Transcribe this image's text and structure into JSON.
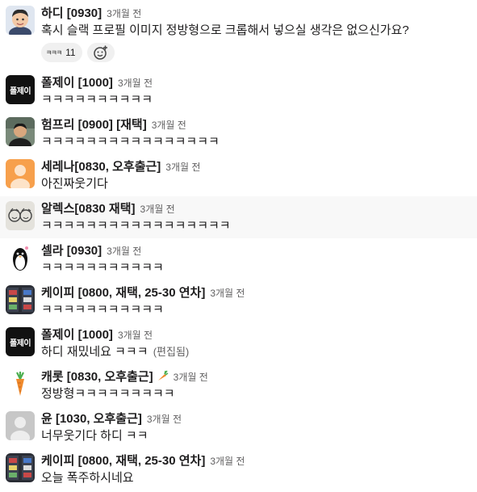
{
  "messages": [
    {
      "name": "하디 [0930]",
      "time": "3개월 전",
      "text": "혹시 슬랙 프로필 이미지 정방형으로 크롭해서 넣으실 생각은 없으신가요?"
    },
    {
      "name": "폴제이 [1000]",
      "time": "3개월 전",
      "text": "ㅋㅋㅋㅋㅋㅋㅋㅋㅋㅋ",
      "avatar_text": "폴제이"
    },
    {
      "name": "험프리 [0900] [재택]",
      "time": "3개월 전",
      "text": "ㅋㅋㅋㅋㅋㅋㅋㅋㅋㅋㅋㅋㅋㅋㅋㅋ"
    },
    {
      "name": "세레나[0830, 오후출근]",
      "time": "3개월 전",
      "text": "아진짜웃기다"
    },
    {
      "name": "알렉스[0830 재택]",
      "time": "3개월 전",
      "text": "ㅋㅋㅋㅋㅋㅋㅋㅋㅋㅋㅋㅋㅋㅋㅋㅋㅋ"
    },
    {
      "name": "셀라 [0930]",
      "time": "3개월 전",
      "text": "ㅋㅋㅋㅋㅋㅋㅋㅋㅋㅋㅋ"
    },
    {
      "name": "케이피 [0800, 재택, 25-30 연차]",
      "time": "3개월 전",
      "text": "ㅋㅋㅋㅋㅋㅋㅋㅋㅋㅋㅋ"
    },
    {
      "name": "폴제이 [1000]",
      "time": "3개월 전",
      "text": "하디 재밌네요 ㅋㅋㅋ",
      "edited": "(편집됨)",
      "avatar_text": "폴제이"
    },
    {
      "name": "캐롯 [0830, 오후출근]",
      "time": "3개월 전",
      "text": "정방형ㅋㅋㅋㅋㅋㅋㅋㅋㅋ"
    },
    {
      "name": "윤 [1030, 오후출근]",
      "time": "3개월 전",
      "text": "너무웃기다 하디 ㅋㅋ"
    },
    {
      "name": "케이피 [0800, 재택, 25-30 연차]",
      "time": "3개월 전",
      "text": "오늘 폭주하시네요"
    }
  ],
  "reaction": {
    "emoji": "ㅋㅋㅋ",
    "count": "11"
  },
  "icons": {
    "add_reaction": "add-reaction-icon",
    "carrot_emoji": "carrot-icon"
  },
  "colors": {
    "name": "#1d1c1d",
    "time": "#616061",
    "highlight": "#f8f8f8",
    "serena_avatar": "#f7a04c"
  }
}
